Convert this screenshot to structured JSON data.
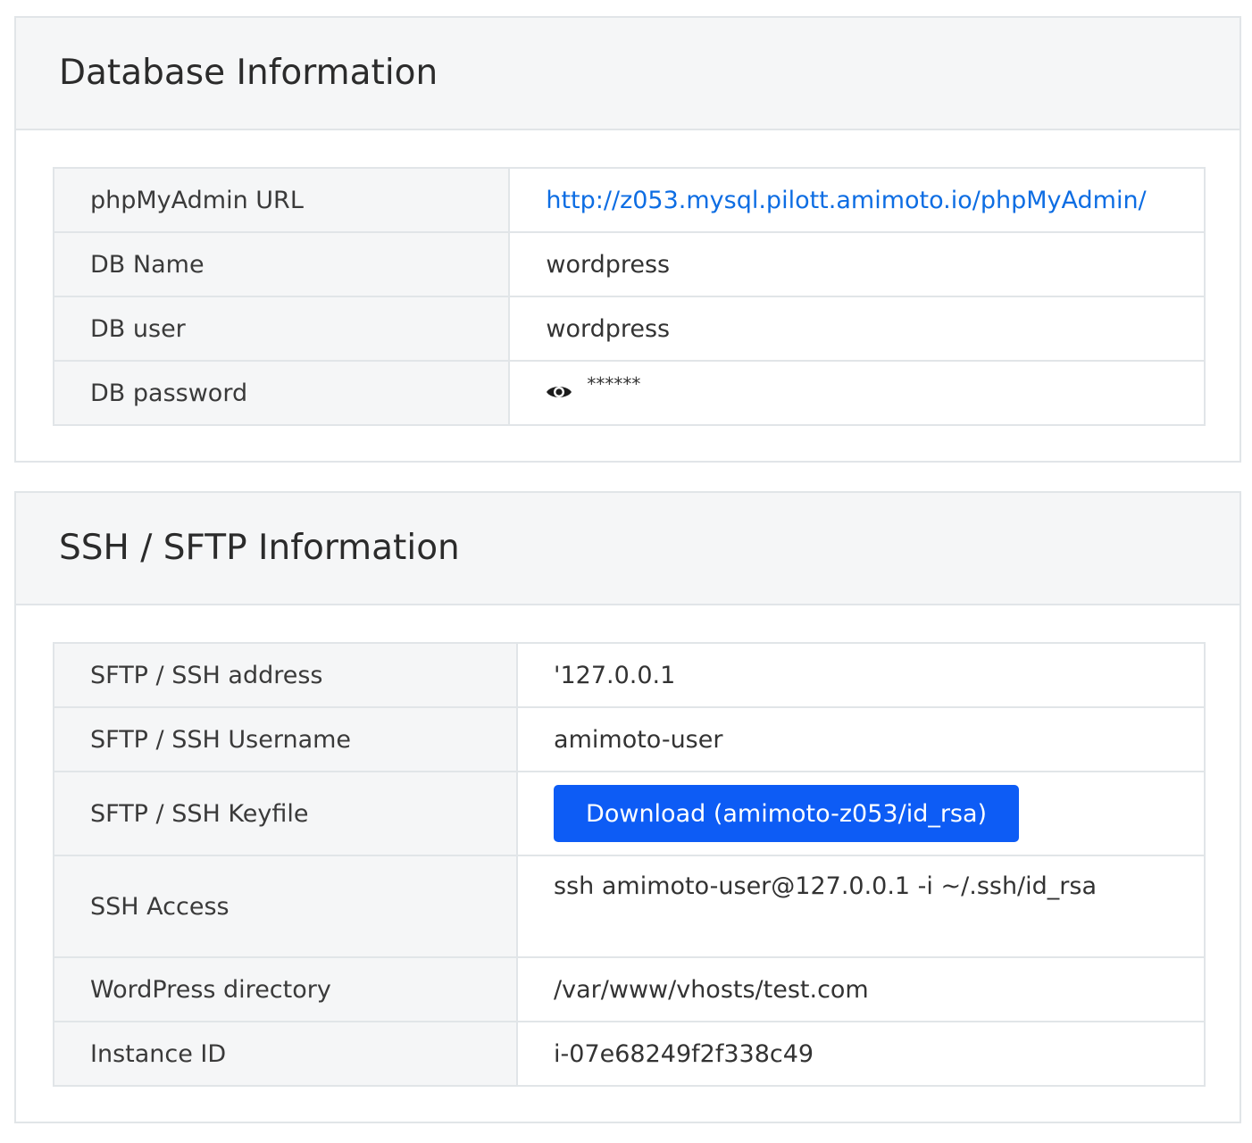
{
  "database": {
    "title": "Database Information",
    "rows": [
      {
        "label": "phpMyAdmin URL",
        "value": "http://z053.mysql.pilott.amimoto.io/phpMyAdmin/"
      },
      {
        "label": "DB Name",
        "value": "wordpress"
      },
      {
        "label": "DB user",
        "value": "wordpress"
      },
      {
        "label": "DB password",
        "value": "******",
        "icon": "eye-icon"
      }
    ]
  },
  "ssh": {
    "title": "SSH / SFTP Information",
    "rows": [
      {
        "label": "SFTP / SSH address",
        "value": "'127.0.0.1"
      },
      {
        "label": "SFTP / SSH Username",
        "value": "amimoto-user"
      },
      {
        "label": "SFTP / SSH Keyfile",
        "button": "Download (amimoto-z053/id_rsa)"
      },
      {
        "label": "SSH Access",
        "value": "ssh amimoto-user@127.0.0.1 -i ~/.ssh/id_rsa"
      },
      {
        "label": "WordPress directory",
        "value": "/var/www/vhosts/test.com"
      },
      {
        "label": "Instance ID",
        "value": "i-07e68249f2f338c49"
      }
    ]
  },
  "colors": {
    "link": "#0d6de3",
    "button": "#0d5cf5",
    "header_bg": "#f5f6f7",
    "border": "#e1e5e8"
  }
}
